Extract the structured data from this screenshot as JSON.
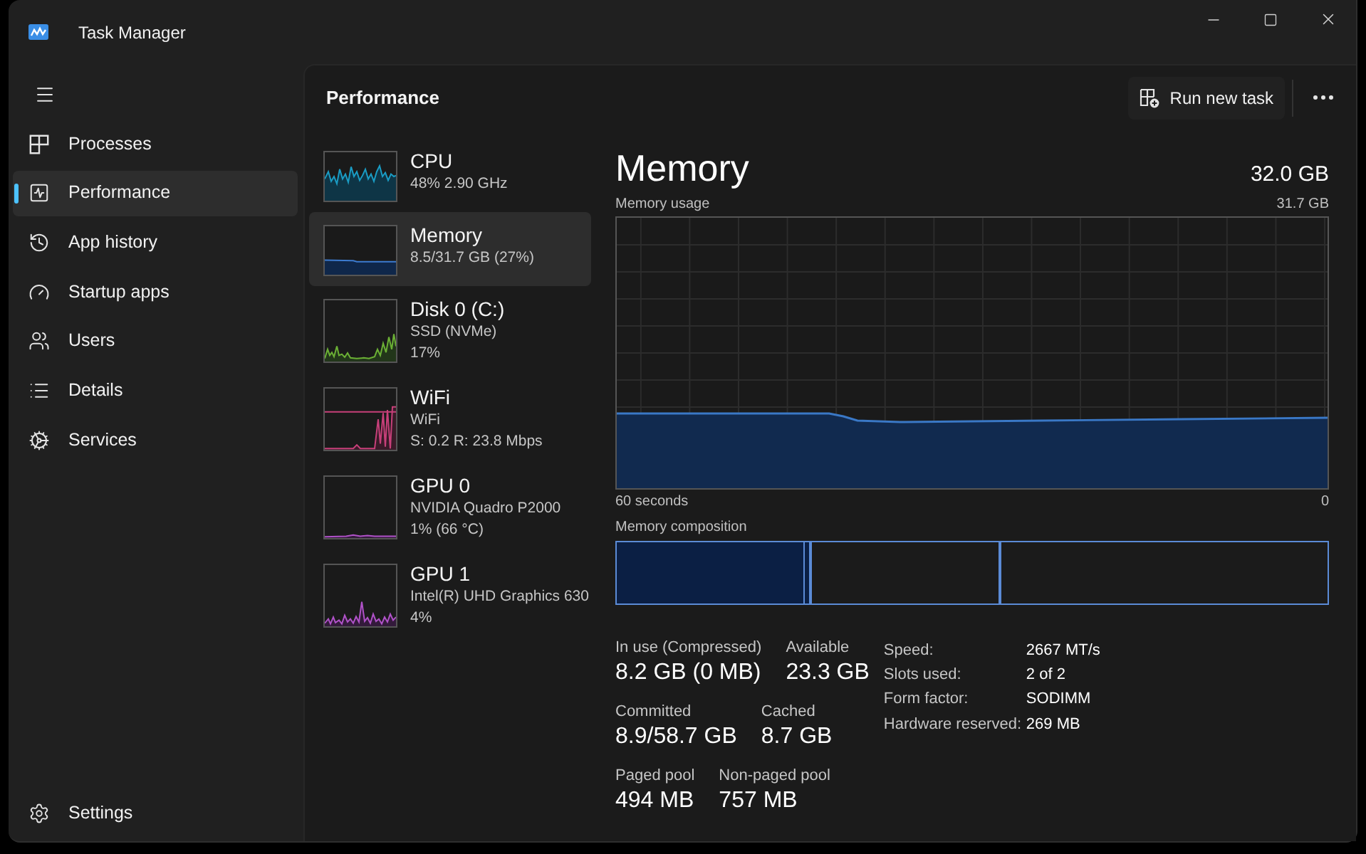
{
  "window": {
    "title": "Task Manager"
  },
  "sidebar": {
    "items": [
      {
        "kind": "processes",
        "label": "Processes",
        "selected": false
      },
      {
        "kind": "performance",
        "label": "Performance",
        "selected": true
      },
      {
        "kind": "app_history",
        "label": "App history",
        "selected": false
      },
      {
        "kind": "startup",
        "label": "Startup apps",
        "selected": false
      },
      {
        "kind": "users",
        "label": "Users",
        "selected": false
      },
      {
        "kind": "details",
        "label": "Details",
        "selected": false
      },
      {
        "kind": "services",
        "label": "Services",
        "selected": false
      }
    ],
    "footer": {
      "label": "Settings"
    }
  },
  "header": {
    "title": "Performance",
    "run_task": "Run new task"
  },
  "devices": [
    {
      "kind": "cpu",
      "name": "CPU",
      "details": [
        "48% 2.90 GHz"
      ],
      "selected": false
    },
    {
      "kind": "memory",
      "name": "Memory",
      "details": [
        "8.5/31.7 GB (27%)"
      ],
      "selected": true
    },
    {
      "kind": "disk",
      "name": "Disk 0 (C:)",
      "details": [
        "SSD (NVMe)",
        "17%"
      ],
      "selected": false
    },
    {
      "kind": "wifi",
      "name": "WiFi",
      "details": [
        "WiFi",
        "S: 0.2 R: 23.8 Mbps"
      ],
      "selected": false
    },
    {
      "kind": "gpu",
      "name": "GPU 0",
      "details": [
        "NVIDIA Quadro P2000",
        "1% (66 °C)"
      ],
      "selected": false
    },
    {
      "kind": "gpu",
      "name": "GPU 1",
      "details": [
        "Intel(R) UHD Graphics 630",
        "4%"
      ],
      "selected": false
    }
  ],
  "detail": {
    "title": "Memory",
    "capacity": "32.0 GB",
    "usage_label": "Memory usage",
    "usage_max": "31.7 GB",
    "time_start": "60 seconds",
    "time_end": "0",
    "composition_label": "Memory composition",
    "stats": [
      [
        {
          "label": "In use (Compressed)",
          "value": "8.2 GB (0 MB)"
        },
        {
          "label": "Available",
          "value": "23.3 GB"
        }
      ],
      [
        {
          "label": "Committed",
          "value": "8.9/58.7 GB"
        },
        {
          "label": "Cached",
          "value": "8.7 GB"
        }
      ],
      [
        {
          "label": "Paged pool",
          "value": "494 MB"
        },
        {
          "label": "Non-paged pool",
          "value": "757 MB"
        }
      ]
    ],
    "properties": [
      {
        "label": "Speed:",
        "value": "2667 MT/s"
      },
      {
        "label": "Slots used:",
        "value": "2 of 2"
      },
      {
        "label": "Form factor:",
        "value": "SODIMM"
      },
      {
        "label": "Hardware reserved:",
        "value": "269 MB"
      }
    ]
  }
}
